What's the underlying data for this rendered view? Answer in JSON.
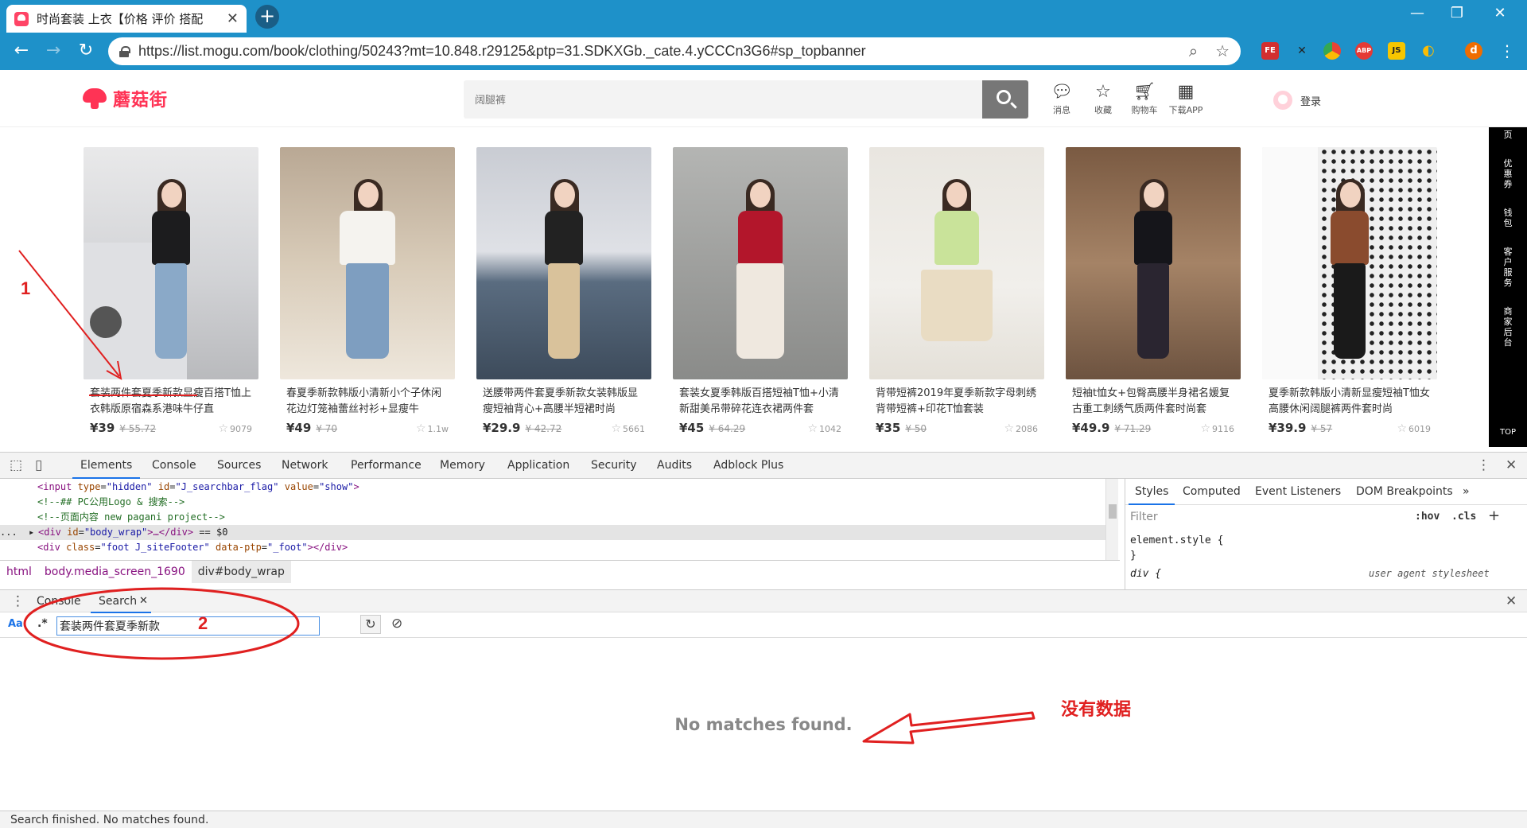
{
  "browser": {
    "tab_title": "时尚套装 上衣【价格 评价 搭配",
    "tab_close": "✕",
    "new_tab": "+",
    "url": "https://list.mogu.com/book/clothing/50243?mt=10.848.r29125&ptp=31.SDKXGb._cate.4.yCCCn3G6#sp_topbanner",
    "ext_badge_fe": "FE",
    "ext_badge_x": "✕",
    "ext_badge_abp": "ABP",
    "ext_badge_js": "JS",
    "profile_initial": "d",
    "win_minimize": "—",
    "win_restore": "❐",
    "win_close": "✕"
  },
  "site": {
    "logo_text": "蘑菇街",
    "search_placeholder": "阔腿裤",
    "nav": {
      "messages": "消息",
      "favorites": "收藏",
      "cart": "购物车",
      "download": "下载APP",
      "login": "登录"
    },
    "rail_items": [
      "页",
      "优惠券",
      "钱包",
      "客户服务",
      "商家后台",
      "TOP"
    ]
  },
  "products": [
    {
      "title": "套装两件套夏季新款显瘦百搭T恤上衣韩版原宿森系港味牛仔直",
      "price": "¥39",
      "original": "¥ 55.72",
      "favs": "9079"
    },
    {
      "title": "春夏季新款韩版小清新小个子休闲花边灯笼袖蕾丝衬衫+显瘦牛",
      "price": "¥49",
      "original": "¥ 70",
      "favs": "1.1w"
    },
    {
      "title": "送腰带两件套夏季新款女装韩版显瘦短袖背心+高腰半短裙时尚",
      "price": "¥29.9",
      "original": "¥ 42.72",
      "favs": "5661"
    },
    {
      "title": "套装女夏季韩版百搭短袖T恤+小清新甜美吊带碎花连衣裙两件套",
      "price": "¥45",
      "original": "¥ 64.29",
      "favs": "1042"
    },
    {
      "title": "背带短裤2019年夏季新款字母刺绣背带短裤+印花T恤套装",
      "price": "¥35",
      "original": "¥ 50",
      "favs": "2086"
    },
    {
      "title": "短袖t恤女+包臀高腰半身裙名媛复古重工刺绣气质两件套时尚套",
      "price": "¥49.9",
      "original": "¥ 71.29",
      "favs": "9116"
    },
    {
      "title": "夏季新款韩版小清新显瘦短袖T恤女高腰休闲阔腿裤两件套时尚",
      "price": "¥39.9",
      "original": "¥ 57",
      "favs": "6019"
    }
  ],
  "devtools": {
    "tabs": [
      "Elements",
      "Console",
      "Sources",
      "Network",
      "Performance",
      "Memory",
      "Application",
      "Security",
      "Audits",
      "Adblock Plus"
    ],
    "code": {
      "l1_tag_open": "<input ",
      "l1_a1": "type",
      "l1_v1": "\"hidden\"",
      "l1_a2": "id",
      "l1_v2": "\"J_searchbar_flag\"",
      "l1_a3": "value",
      "l1_v3": "\"show\"",
      "l1_tag_close": ">",
      "l2": "<!--## PC公用Logo & 搜索-->",
      "l3": "<!--页面内容 new pagani project-->",
      "l4_prefix": "...",
      "l4_tag_open": "<div ",
      "l4_a1": "id",
      "l4_v1": "\"body_wrap\"",
      "l4_tag_mid": ">…</div>",
      "l4_suffix": " == $0",
      "l5_tag_open": "<div ",
      "l5_a1": "class",
      "l5_v1": "\"foot J_siteFooter\"",
      "l5_a2": "data-ptp",
      "l5_v2": "\"_foot\"",
      "l5_tag_close": "></div>"
    },
    "styles_tabs": [
      "Styles",
      "Computed",
      "Event Listeners",
      "DOM Breakpoints"
    ],
    "styles_more": "»",
    "filter_placeholder": "Filter",
    "hov": ":hov",
    "cls": ".cls",
    "add_rule": "+",
    "element_style": "element.style {",
    "close_brace": "}",
    "div_rule": "div {",
    "user_agent": "user agent stylesheet",
    "breadcrumbs": [
      "html",
      "body.media_screen_1690",
      "div#body_wrap"
    ],
    "drawer_tabs": [
      "Console",
      "Search"
    ],
    "search_case": "Aa",
    "search_regex": ".*",
    "search_query": "套装两件套夏季新款",
    "no_matches": "No matches found.",
    "status": "Search finished.  No matches found."
  },
  "annotations": {
    "label_1": "1",
    "label_2": "2",
    "note": "没有数据"
  }
}
